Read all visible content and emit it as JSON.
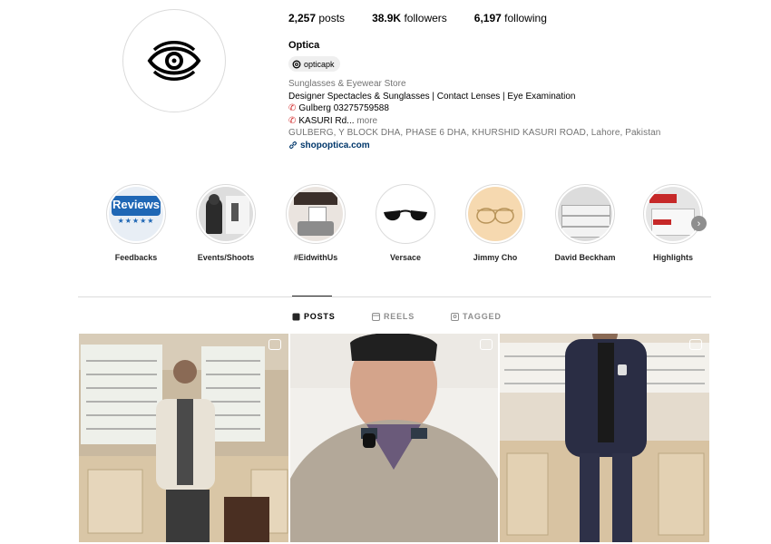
{
  "profile": {
    "username": "Optica",
    "stats": {
      "posts_value": "2,257",
      "posts_label": "posts",
      "followers_value": "38.9K",
      "followers_label": "followers",
      "following_value": "6,197",
      "following_label": "following"
    },
    "threads_handle": "opticapk",
    "bio": {
      "category": "Sunglasses & Eyewear Store",
      "line1": "Designer Spectacles & Sunglasses | Contact Lenses | Eye Examination",
      "line2": "Gulberg 03275759588",
      "line3": "KASURI Rd...",
      "more": "more",
      "address": "GULBERG, Y BLOCK DHA, PHASE 6 DHA, KHURSHID KASURI ROAD, Lahore, Pakistan",
      "link": "shopoptica.com"
    }
  },
  "highlights": [
    {
      "label": "Feedbacks",
      "badge": "Reviews"
    },
    {
      "label": "Events/Shoots"
    },
    {
      "label": "#EidwithUs"
    },
    {
      "label": "Versace"
    },
    {
      "label": "Jimmy Cho"
    },
    {
      "label": "David Beckham"
    },
    {
      "label": "Highlights"
    }
  ],
  "tabs": {
    "posts": "POSTS",
    "reels": "REELS",
    "tagged": "TAGGED"
  },
  "colors": {
    "link": "#00376b",
    "muted": "#737373",
    "phone_icon": "#d32f2f",
    "divider": "#dbdbdb"
  },
  "icons": {
    "avatar": "eye-logo-icon",
    "threads": "threads-icon",
    "phone": "phone-icon",
    "link": "link-icon",
    "next": "chevron-right-icon",
    "posts": "grid-icon",
    "reels": "reels-icon",
    "tagged": "tagged-icon",
    "post_type": "reel-icon"
  }
}
